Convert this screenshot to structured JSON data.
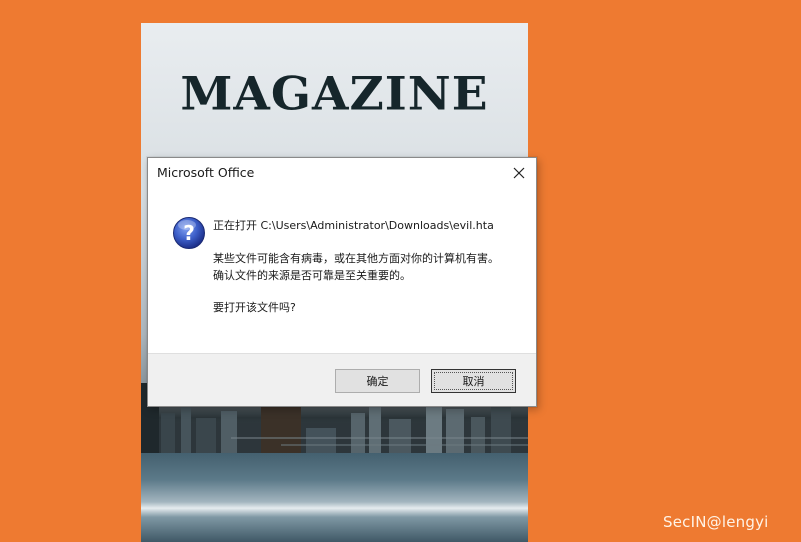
{
  "background": {
    "color": "#ee7a31",
    "cover_title": "MAGAZINE"
  },
  "dialog": {
    "title": "Microsoft Office",
    "icon": "question-icon",
    "lines": [
      "正在打开 C:\\Users\\Administrator\\Downloads\\evil.hta",
      "某些文件可能含有病毒，或在其他方面对你的计算机有害。",
      "确认文件的来源是否可靠是至关重要的。",
      "要打开该文件吗?"
    ],
    "ok_label": "确定",
    "cancel_label": "取消",
    "close_icon": "close-icon"
  },
  "watermark": "SecIN@lengyi"
}
